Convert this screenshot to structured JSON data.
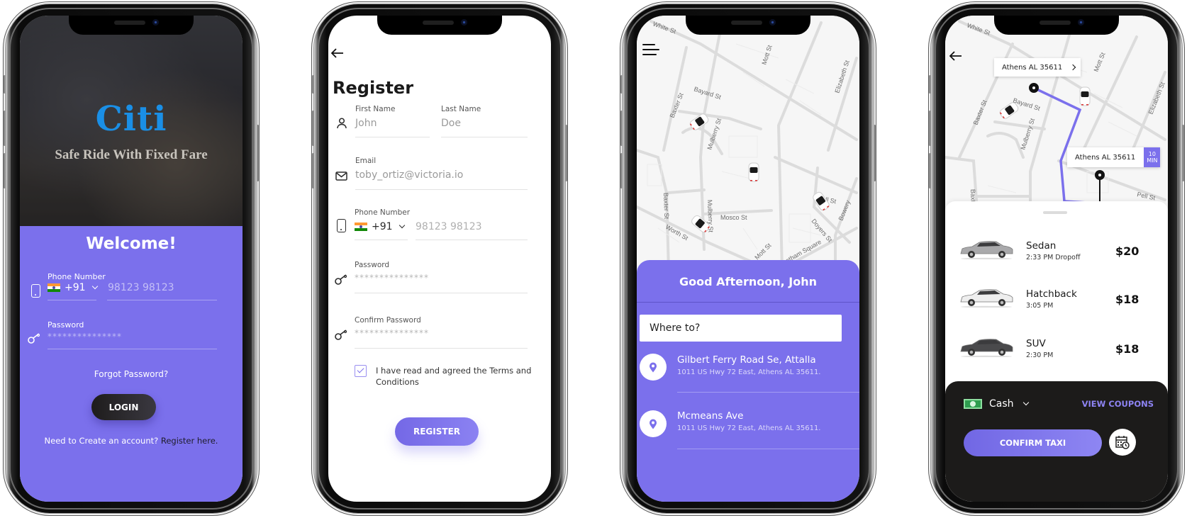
{
  "login": {
    "brand": "Citi",
    "tagline": "Safe Ride With Fixed Fare",
    "welcome": "Welcome!",
    "phone_label": "Phone Number",
    "country_code": "+91",
    "phone_placeholder": "98123 98123",
    "password_label": "Password",
    "password_value": "***************",
    "forgot": "Forgot Password?",
    "login_button": "LOGIN",
    "create_prompt": "Need to Create an account?",
    "register_link": "Register here.",
    "colors": {
      "accent": "#7b70ec",
      "brand": "#1a8fe6",
      "button": "#1e1c1c"
    }
  },
  "register": {
    "title": "Register",
    "first_name_label": "First Name",
    "first_name_placeholder": "John",
    "last_name_label": "Last  Name",
    "last_name_placeholder": "Doe",
    "email_label": "Email",
    "email_placeholder": "toby_ortiz@victoria.io",
    "phone_label": "Phone Number",
    "country_code": "+91",
    "phone_placeholder": "98123 98123",
    "password_label": "Password",
    "password_value": "***************",
    "confirm_label": "Confirm Password",
    "confirm_value": "***************",
    "terms_checked": true,
    "terms": "I have read and agreed the Terms and Conditions",
    "register_button": "REGISTER"
  },
  "home": {
    "streets": [
      "White St",
      "Bayard St",
      "Baxter St",
      "Mulberry St",
      "Mott St",
      "Elizabeth St",
      "Baxter St",
      "Mosco St",
      "Pell St",
      "Worth St",
      "Doyers St",
      "Mulberry St",
      "Mott St",
      "Chatham Square",
      "Bowery"
    ],
    "greeting": "Good Afternoon, John",
    "where_placeholder": "Where to?",
    "places": [
      {
        "title": "Gilbert Ferry Road Se, Attalla",
        "address": "1011 US Hwy 72 East, Athens AL 35611."
      },
      {
        "title": "Mcmeans Ave",
        "address": "1011 US Hwy 72 East, Athens AL 35611."
      }
    ]
  },
  "ride": {
    "pickup_tag": "Athens AL 35611",
    "dropoff_tag": "Athens AL 35611",
    "eta_value": "10",
    "eta_unit": "MIN",
    "options": [
      {
        "name": "Sedan",
        "time": "2:33 PM Dropoff",
        "price": "$20",
        "color": "#a9a9ab"
      },
      {
        "name": "Hatchback",
        "time": "3:05 PM",
        "price": "$18",
        "color": "#eeeeee"
      },
      {
        "name": "SUV",
        "time": "2:30 PM",
        "price": "$18",
        "color": "#4a4a4c"
      }
    ],
    "payment_method": "Cash",
    "view_coupons": "VIEW COUPONS",
    "confirm_button": "CONFIRM TAXI",
    "route_color": "#7b70ec"
  }
}
